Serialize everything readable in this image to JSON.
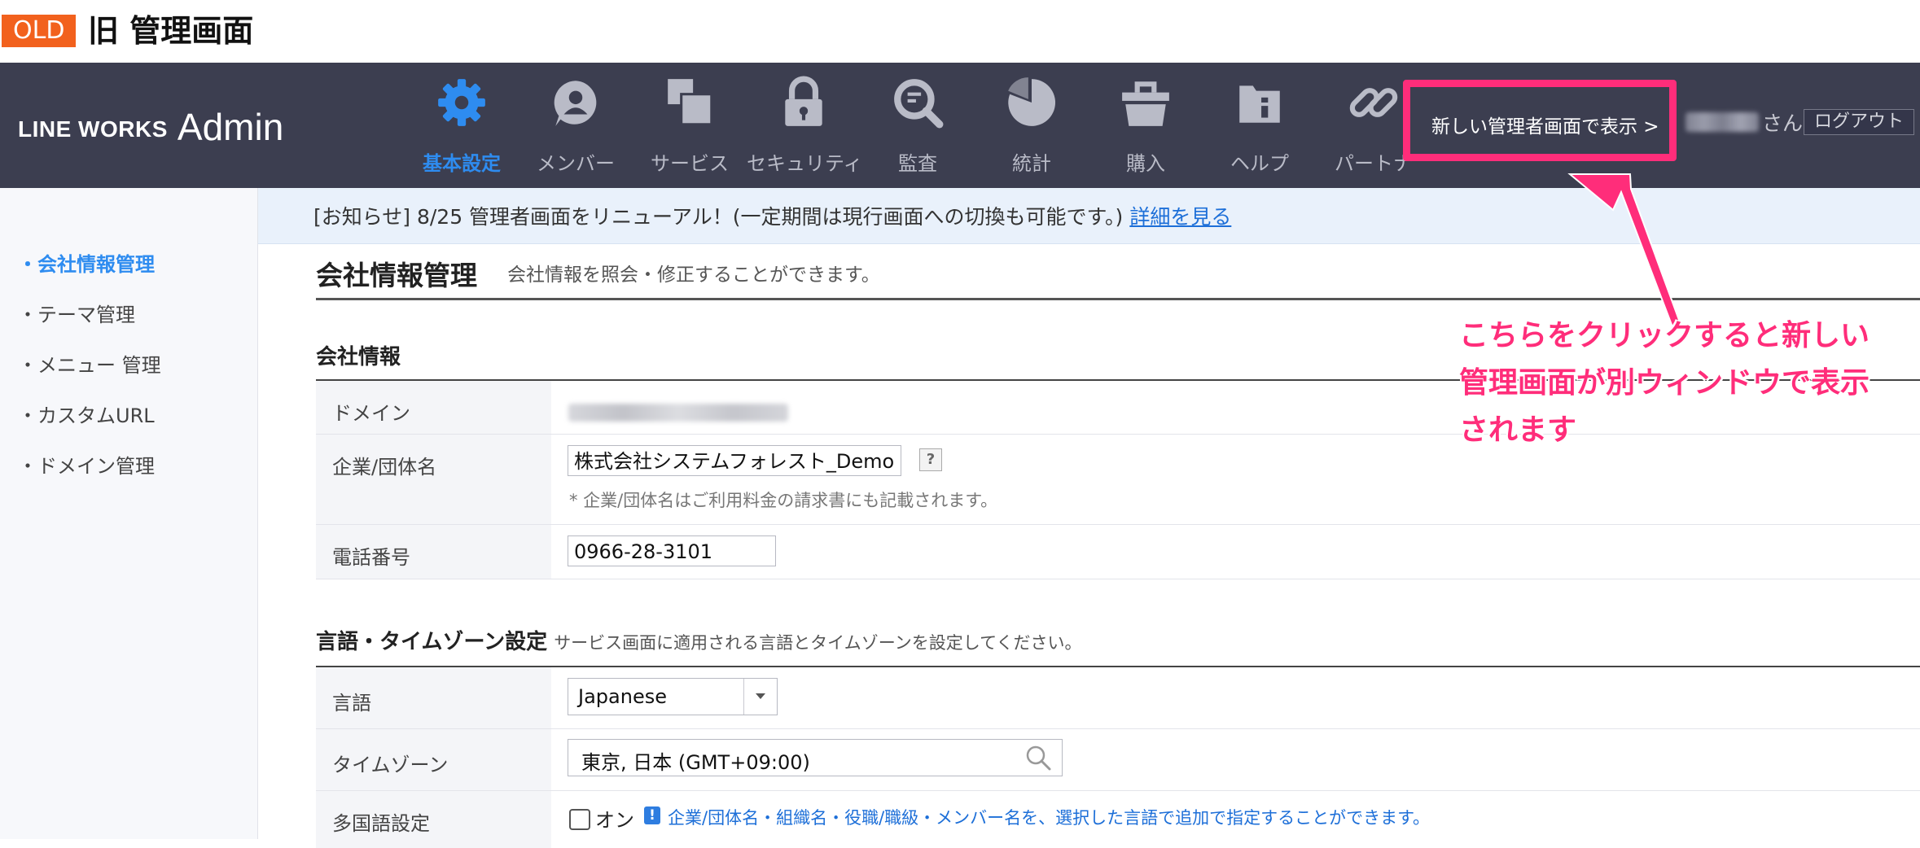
{
  "heading": {
    "badge": "OLD",
    "title": "旧 管理画面"
  },
  "header": {
    "logo_brand": "LINE WORKS",
    "logo_admin": "Admin",
    "nav": [
      {
        "label": "基本設定",
        "icon": "gear-icon",
        "active": true
      },
      {
        "label": "メンバー",
        "icon": "person-icon",
        "active": false
      },
      {
        "label": "サービス",
        "icon": "service-icon",
        "active": false
      },
      {
        "label": "セキュリティ",
        "icon": "lock-icon",
        "active": false
      },
      {
        "label": "監査",
        "icon": "audit-search-icon",
        "active": false
      },
      {
        "label": "統計",
        "icon": "pie-chart-icon",
        "active": false
      },
      {
        "label": "購入",
        "icon": "basket-icon",
        "active": false
      },
      {
        "label": "ヘルプ",
        "icon": "help-book-icon",
        "active": false
      },
      {
        "label": "パートナ",
        "icon": "link-icon",
        "active": false
      }
    ],
    "new_admin_link": "新しい管理者画面で表示 >",
    "user_suffix": "さん",
    "logout": "ログアウト"
  },
  "sidebar": {
    "items": [
      {
        "label": "会社情報管理",
        "active": true
      },
      {
        "label": "テーマ管理",
        "active": false
      },
      {
        "label": "メニュー 管理",
        "active": false
      },
      {
        "label": "カスタムURL",
        "active": false
      },
      {
        "label": "ドメイン管理",
        "active": false
      }
    ]
  },
  "notice": {
    "text": "[お知らせ] 8/25 管理者画面をリニューアル！(一定期間は現行画面への切換も可能です。)",
    "link": "詳細を見る"
  },
  "main": {
    "title": "会社情報管理",
    "description": "会社情報を照会・修正することができます。",
    "company": {
      "title": "会社情報",
      "domain_label": "ドメイン",
      "name_label": "企業/団体名",
      "name_value": "株式会社システムフォレスト_Demo",
      "help": "?",
      "name_hint": "* 企業/団体名はご利用料金の請求書にも記載されます。",
      "phone_label": "電話番号",
      "phone_value": "0966-28-3101"
    },
    "locale": {
      "title": "言語・タイムゾーン設定",
      "note": "サービス画面に適用される言語とタイムゾーンを設定してください。",
      "language_label": "言語",
      "language_value": "Japanese",
      "timezone_label": "タイムゾーン",
      "timezone_value": "東京, 日本 (GMT+09:00)",
      "multilang_label": "多国語設定",
      "multilang_toggle": "オン",
      "multilang_checked": false,
      "info_badge": "!",
      "multilang_info": "企業/団体名・組織名・役職/職級・メンバー名を、選択した言語で追加で指定することができます。"
    }
  },
  "annotation": {
    "color": "#ff2d7a",
    "lines": [
      "こちらをクリックすると新しい",
      "管理画面が別ウィンドウで表示",
      "されます"
    ]
  },
  "colors": {
    "navbar": "#3c3e50",
    "accent": "#2e8cf0",
    "badge": "#f2611d"
  }
}
